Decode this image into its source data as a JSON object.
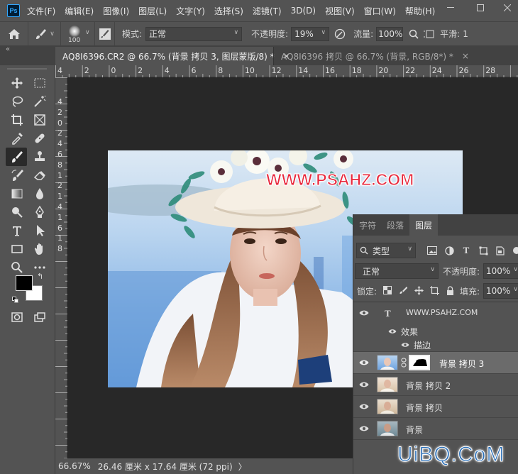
{
  "menubar": {
    "logo": "Ps",
    "items": [
      "文件(F)",
      "编辑(E)",
      "图像(I)",
      "图层(L)",
      "文字(Y)",
      "选择(S)",
      "滤镜(T)",
      "3D(D)",
      "视图(V)",
      "窗口(W)",
      "帮助(H)"
    ]
  },
  "options": {
    "brush_size": "100",
    "mode_label": "模式:",
    "mode_value": "正常",
    "opacity_label": "不透明度:",
    "opacity_value": "19%",
    "flow_label": "流量:",
    "flow_value": "100%",
    "smoothing_label": "平滑:",
    "smoothing_value": "1"
  },
  "tabs": [
    {
      "label": "AQ8I6396.CR2 @ 66.7% (背景 拷贝 3, 图层蒙版/8) *",
      "close": "×",
      "active": true
    },
    {
      "label": "AQ8I6396 拷贝 @ 66.7% (背景, RGB/8*) *",
      "close": "×",
      "active": false
    }
  ],
  "ruler_top": [
    "4",
    "2",
    "0",
    "2",
    "4",
    "6",
    "8",
    "10",
    "12",
    "14",
    "16",
    "18",
    "20",
    "22",
    "24",
    "26",
    "28"
  ],
  "ruler_left": [
    "4",
    "2",
    "0",
    "2",
    "4",
    "6",
    "8",
    "1",
    "2",
    "1",
    "4",
    "1",
    "6",
    "1",
    "8"
  ],
  "status": {
    "zoom": "66.67%",
    "doc_info": "26.46 厘米 x 17.64 厘米 (72 ppi)",
    "arrow": "〉"
  },
  "canvas": {
    "watermark": "WWW.PSAHZ.COM"
  },
  "layers_panel": {
    "tabs": [
      "字符",
      "段落",
      "图层"
    ],
    "filter_kind": "类型",
    "blend_mode": "正常",
    "opacity_label": "不透明度:",
    "opacity_value": "100%",
    "lock_label": "锁定:",
    "fill_label": "填充:",
    "fill_value": "100%",
    "layers": [
      {
        "name": "WWW.PSAHZ.COM",
        "type": "text"
      },
      {
        "name": "效果",
        "type": "effects"
      },
      {
        "name": "描边",
        "type": "effect-item"
      },
      {
        "name": "背景 拷贝 3",
        "type": "masked",
        "selected": true
      },
      {
        "name": "背景 拷贝 2",
        "type": "pixel"
      },
      {
        "name": "背景 拷贝",
        "type": "pixel"
      },
      {
        "name": "背景",
        "type": "pixel"
      }
    ]
  },
  "site_watermark": "UiBQ.CoM",
  "colors": {
    "accent": "#31a8ff",
    "panel": "#535353",
    "workspace": "#282828",
    "selected_layer": "#6b6b6b",
    "watermark_red": "#e8283c",
    "site_watermark": "#2a6fb8"
  }
}
